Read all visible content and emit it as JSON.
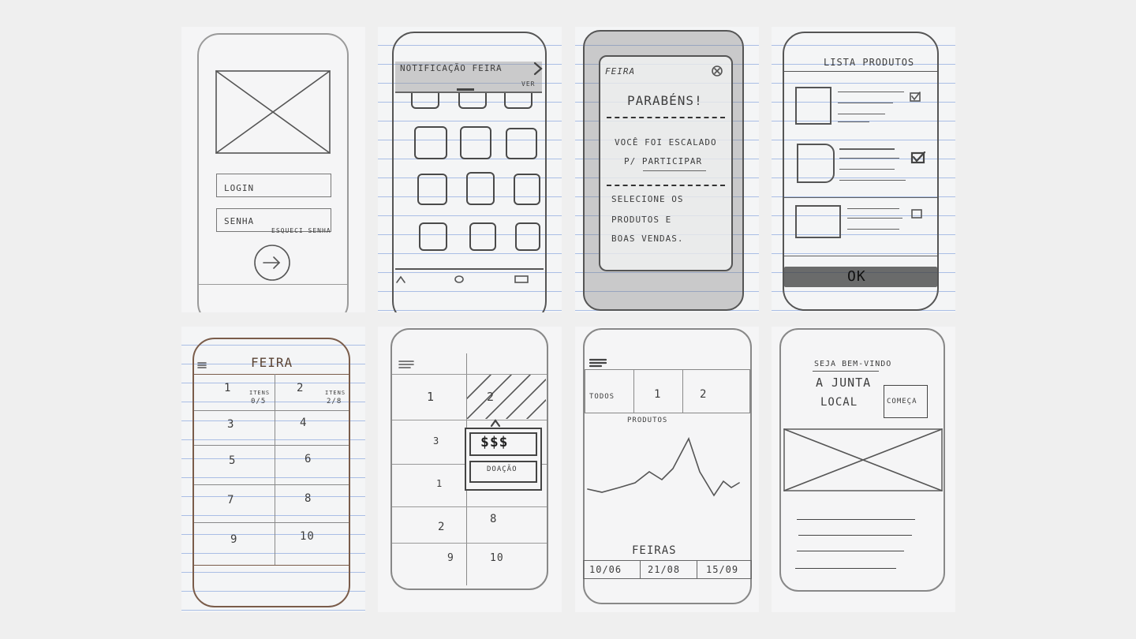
{
  "sketches": {
    "login": {
      "login_field": "LOGIN",
      "password_field": "SENHA",
      "forgot_link": "ESQUECI SENHA",
      "submit_icon": "arrow-right-icon"
    },
    "notification": {
      "banner_title": "NOTIFICAÇÃO FEIRA",
      "see_link": "VER",
      "nav_icons": [
        "home-icon",
        "drop-icon",
        "square-icon"
      ]
    },
    "congrats": {
      "fair_label": "FEIRA",
      "title": "PARABÉNS!",
      "message_lines": [
        "VOCÊ FOI ESCALADO",
        "P/ PARTICIPAR"
      ],
      "instruction_lines": [
        "SELECIONE OS",
        "PRODUTOS E",
        "BOAS VENDAS."
      ],
      "close_icon": "close-icon"
    },
    "product_list": {
      "title": "LISTA PRODUTOS",
      "ok_button": "OK"
    },
    "fair_grid": {
      "title": "FEIRA",
      "cells": [
        "1",
        "2",
        "3",
        "4",
        "5",
        "6",
        "7",
        "8",
        "9",
        "10"
      ],
      "cell1_note": [
        "ITENS",
        "0/5"
      ],
      "cell2_note": [
        "ITENS",
        "2/8"
      ]
    },
    "donation": {
      "cells": [
        "1",
        "2",
        "3",
        "1",
        "2",
        "8",
        "9",
        "10"
      ],
      "price_label": "$$$",
      "donate_label": "DOAÇÃO"
    },
    "chart_screen": {
      "tabs": [
        "TODOS",
        "1",
        "2"
      ],
      "chart_label": "PRODUTOS",
      "fairs_label": "FEIRAS",
      "dates": [
        "10/06",
        "21/08",
        "15/09"
      ]
    },
    "welcome": {
      "greeting": "SEJA BEM-VINDO",
      "brand_lines": [
        "A JUNTA",
        "LOCAL"
      ],
      "start_button": "COMEÇA"
    }
  }
}
